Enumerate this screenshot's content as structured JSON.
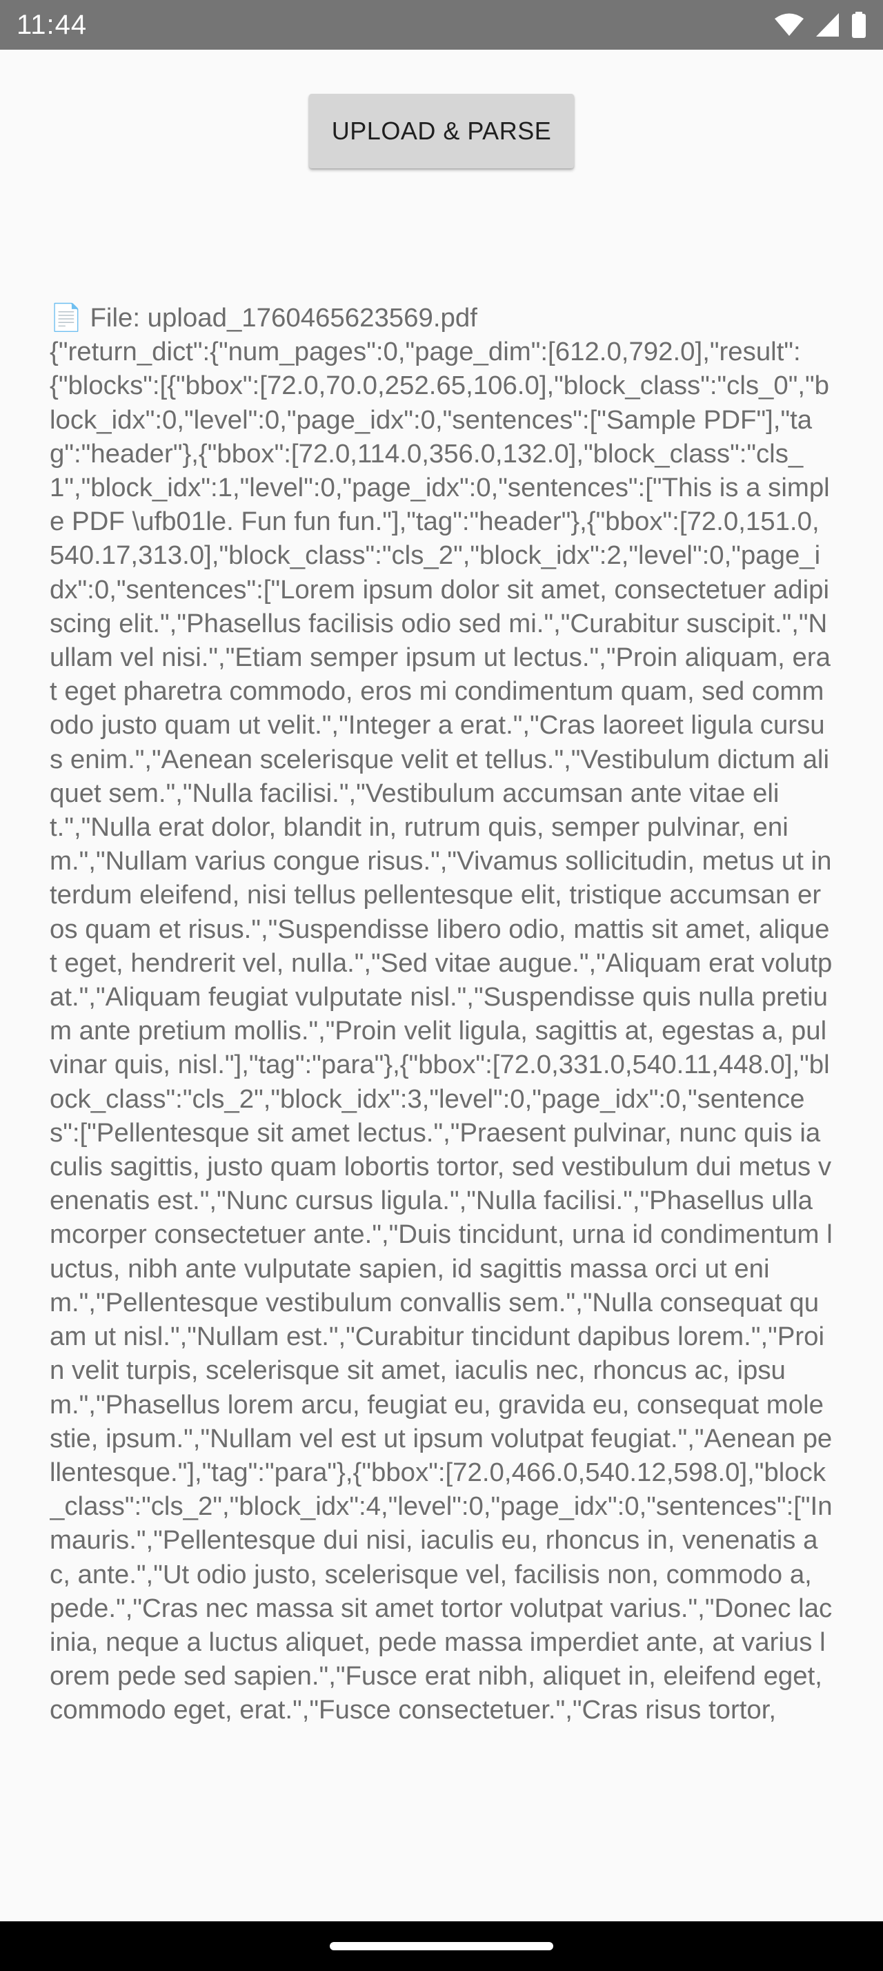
{
  "status_bar": {
    "time": "11:44",
    "icons": [
      "wifi-icon",
      "cellular-signal-icon",
      "battery-icon"
    ]
  },
  "main": {
    "upload_button_label": "UPLOAD & PARSE",
    "result_text": "📄 File: upload_1760465623569.pdf\n{\"return_dict\":{\"num_pages\":0,\"page_dim\":[612.0,792.0],\"result\":{\"blocks\":[{\"bbox\":[72.0,70.0,252.65,106.0],\"block_class\":\"cls_0\",\"block_idx\":0,\"level\":0,\"page_idx\":0,\"sentences\":[\"Sample PDF\"],\"tag\":\"header\"},{\"bbox\":[72.0,114.0,356.0,132.0],\"block_class\":\"cls_1\",\"block_idx\":1,\"level\":0,\"page_idx\":0,\"sentences\":[\"This is a simple PDF \\ufb01le. Fun fun fun.\"],\"tag\":\"header\"},{\"bbox\":[72.0,151.0,540.17,313.0],\"block_class\":\"cls_2\",\"block_idx\":2,\"level\":0,\"page_idx\":0,\"sentences\":[\"Lorem ipsum dolor sit amet, consectetuer adipiscing elit.\",\"Phasellus facilisis odio sed mi.\",\"Curabitur suscipit.\",\"Nullam vel nisi.\",\"Etiam semper ipsum ut lectus.\",\"Proin aliquam, erat eget pharetra commodo, eros mi condimentum quam, sed commodo justo quam ut velit.\",\"Integer a erat.\",\"Cras laoreet ligula cursus enim.\",\"Aenean scelerisque velit et tellus.\",\"Vestibulum dictum aliquet sem.\",\"Nulla facilisi.\",\"Vestibulum accumsan ante vitae elit.\",\"Nulla erat dolor, blandit in, rutrum quis, semper pulvinar, enim.\",\"Nullam varius congue risus.\",\"Vivamus sollicitudin, metus ut interdum eleifend, nisi tellus pellentesque elit, tristique accumsan eros quam et risus.\",\"Suspendisse libero odio, mattis sit amet, aliquet eget, hendrerit vel, nulla.\",\"Sed vitae augue.\",\"Aliquam erat volutpat.\",\"Aliquam feugiat vulputate nisl.\",\"Suspendisse quis nulla pretium ante pretium mollis.\",\"Proin velit ligula, sagittis at, egestas a, pulvinar quis, nisl.\"],\"tag\":\"para\"},{\"bbox\":[72.0,331.0,540.11,448.0],\"block_class\":\"cls_2\",\"block_idx\":3,\"level\":0,\"page_idx\":0,\"sentences\":[\"Pellentesque sit amet lectus.\",\"Praesent pulvinar, nunc quis iaculis sagittis, justo quam lobortis tortor, sed vestibulum dui metus venenatis est.\",\"Nunc cursus ligula.\",\"Nulla facilisi.\",\"Phasellus ullamcorper consectetuer ante.\",\"Duis tincidunt, urna id condimentum luctus, nibh ante vulputate sapien, id sagittis massa orci ut enim.\",\"Pellentesque vestibulum convallis sem.\",\"Nulla consequat quam ut nisl.\",\"Nullam est.\",\"Curabitur tincidunt dapibus lorem.\",\"Proin velit turpis, scelerisque sit amet, iaculis nec, rhoncus ac, ipsum.\",\"Phasellus lorem arcu, feugiat eu, gravida eu, consequat molestie, ipsum.\",\"Nullam vel est ut ipsum volutpat feugiat.\",\"Aenean pellentesque.\"],\"tag\":\"para\"},{\"bbox\":[72.0,466.0,540.12,598.0],\"block_class\":\"cls_2\",\"block_idx\":4,\"level\":0,\"page_idx\":0,\"sentences\":[\"In mauris.\",\"Pellentesque dui nisi, iaculis eu, rhoncus in, venenatis ac, ante.\",\"Ut odio justo, scelerisque vel, facilisis non, commodo a, pede.\",\"Cras nec massa sit amet tortor volutpat varius.\",\"Donec lacinia, neque a luctus aliquet, pede massa imperdiet ante, at varius lorem pede sed sapien.\",\"Fusce erat nibh, aliquet in, eleifend eget, commodo eget, erat.\",\"Fusce consectetuer.\",\"Cras risus tortor,"
  },
  "colors": {
    "status_bar_bg": "#757575",
    "app_bg": "#fafafa",
    "button_bg": "#d6d6d6",
    "text": "#6d6d6d",
    "nav_bar_bg": "#000000"
  }
}
